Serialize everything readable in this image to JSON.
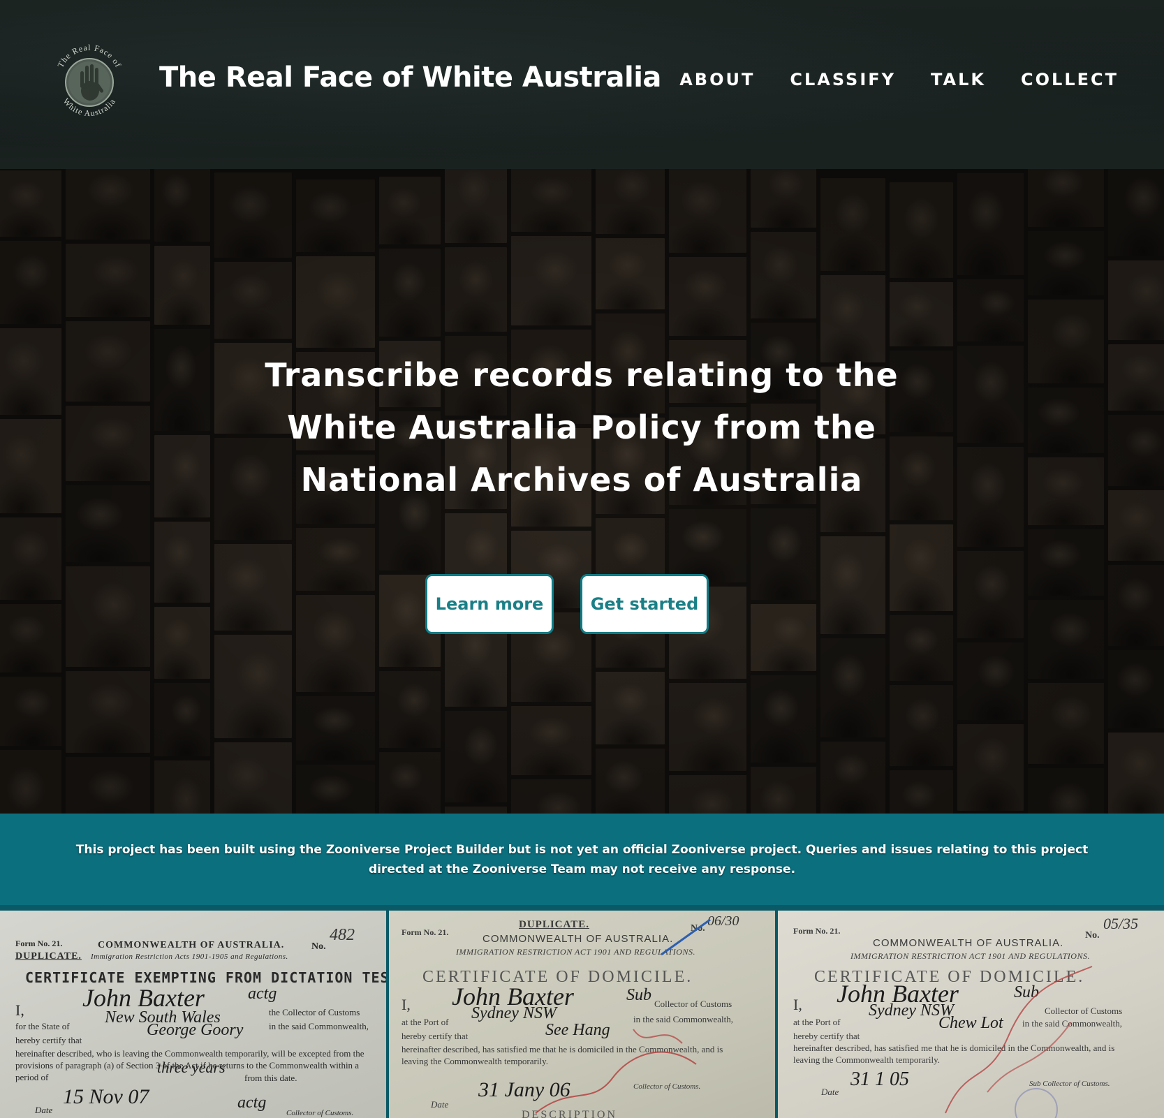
{
  "header": {
    "logo_text_top": "The Real Face of",
    "logo_text_bottom": "White Australia",
    "title": "The Real Face of White Australia",
    "nav": [
      "ABOUT",
      "CLASSIFY",
      "TALK",
      "COLLECT"
    ]
  },
  "hero": {
    "heading_line1": "Transcribe records relating to the",
    "heading_line2": "White Australia Policy from the",
    "heading_line3": "National Archives of Australia",
    "learn_more": "Learn more",
    "get_started": "Get started"
  },
  "banner": {
    "text": "This project has been built using the Zooniverse Project Builder but is not yet an official Zooniverse project. Queries and issues relating to this project directed at the Zooniverse Team may not receive any response."
  },
  "documents": [
    {
      "form": "Form No. 21.",
      "duplicate": "DUPLICATE.",
      "commonwealth": "COMMONWEALTH OF AUSTRALIA.",
      "act": "Immigration Restriction Acts 1901-1905 and Regulations.",
      "no_label": "No.",
      "no_value": "482",
      "certificate": "CERTIFICATE EXEMPTING FROM DICTATION TEST.",
      "line1": "I,",
      "collector": "the Collector of Customs",
      "state": "for the State of",
      "commonwealth_line": "in the said Commonwealth,",
      "certify": "hereby certify that",
      "body": "hereinafter described, who is leaving the Commonwealth temporarily, will be excepted from the provisions of paragraph (a) of Section 3 of the Act if he returns to the Commonwealth within a period of",
      "from_date": "from this date.",
      "date_label": "Date",
      "collector_sig": "Collector of Customs.",
      "hand_name": "John Baxter",
      "hand_rank": "actg",
      "hand_state": "New South Wales",
      "hand_person": "George Goory",
      "hand_period": "three years",
      "hand_date": "15 Nov 07",
      "hand_sig": "actg"
    },
    {
      "form": "Form No. 21.",
      "duplicate": "DUPLICATE.",
      "commonwealth": "COMMONWEALTH OF AUSTRALIA.",
      "act": "IMMIGRATION RESTRICTION ACT 1901 AND REGULATIONS.",
      "no_label": "No.",
      "no_value": "06/30",
      "certificate": "CERTIFICATE OF DOMICILE.",
      "line1": "I,",
      "collector": "Collector of Customs",
      "port": "at the Port of",
      "commonwealth_line": "in the said Commonwealth,",
      "certify": "hereby certify that",
      "body": "hereinafter described, has satisfied me that he is domiciled in the Commonwealth, and is leaving the Commonwealth temporarily.",
      "date_label": "Date",
      "collector_sig": "Collector of Customs.",
      "hand_name": "John Baxter",
      "hand_rank": "Sub",
      "hand_port": "Sydney NSW",
      "hand_person": "See Hang",
      "hand_date": "31 Jany 06",
      "description": "DESCRIPTION"
    },
    {
      "form": "Form No. 21.",
      "commonwealth": "COMMONWEALTH OF AUSTRALIA.",
      "act": "IMMIGRATION RESTRICTION ACT 1901 AND REGULATIONS.",
      "no_label": "No.",
      "no_value": "05/35",
      "certificate": "CERTIFICATE OF DOMICILE.",
      "line1": "I,",
      "collector": "Collector of Customs",
      "port": "at the Port of",
      "commonwealth_line": "in the said Commonwealth,",
      "certify": "hereby certify that",
      "body": "hereinafter described, has satisfied me that he is domiciled in the Commonwealth, and is leaving the Commonwealth temporarily.",
      "date_label": "Date",
      "collector_sig": "Sub Collector of Customs.",
      "hand_name": "John Baxter",
      "hand_rank": "Sub",
      "hand_port": "Sydney NSW",
      "hand_person": "Chew Lot",
      "hand_date": "31 1 05"
    }
  ],
  "colors": {
    "accent": "#0b6f7e",
    "button_text": "#1a7f86",
    "button_border": "#0f7c86"
  }
}
